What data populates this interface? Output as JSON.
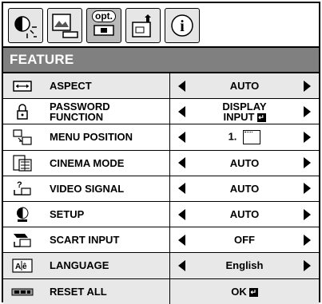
{
  "tabs": [
    {
      "name": "picture-tab",
      "icon": "contrast-sun-icon"
    },
    {
      "name": "image-tab",
      "icon": "picture-monitor-icon"
    },
    {
      "name": "option-tab",
      "icon": "option-icon",
      "label": "opt.",
      "active": true
    },
    {
      "name": "installation-tab",
      "icon": "installation-icon"
    },
    {
      "name": "info-tab",
      "icon": "info-icon"
    }
  ],
  "header": {
    "title": "FEATURE"
  },
  "rows": [
    {
      "label": "ASPECT",
      "value": "AUTO",
      "icon": "aspect-icon"
    },
    {
      "label_line1": "PASSWORD",
      "label_line2": "FUNCTION",
      "value_line1": "DISPLAY",
      "value_line2": "INPUT",
      "icon": "lock-icon"
    },
    {
      "label": "MENU POSITION",
      "value": "1.",
      "icon": "menu-position-icon"
    },
    {
      "label": "CINEMA MODE",
      "value": "AUTO",
      "icon": "cinema-mode-icon"
    },
    {
      "label": "VIDEO SIGNAL",
      "value": "AUTO",
      "icon": "video-signal-icon"
    },
    {
      "label": "SETUP",
      "value": "AUTO",
      "icon": "setup-icon"
    },
    {
      "label": "SCART INPUT",
      "value": "OFF",
      "icon": "scart-input-icon"
    },
    {
      "label": "LANGUAGE",
      "value": "English",
      "icon": "language-icon"
    },
    {
      "label": "RESET ALL",
      "value": "OK",
      "icon": "reset-icon"
    }
  ]
}
